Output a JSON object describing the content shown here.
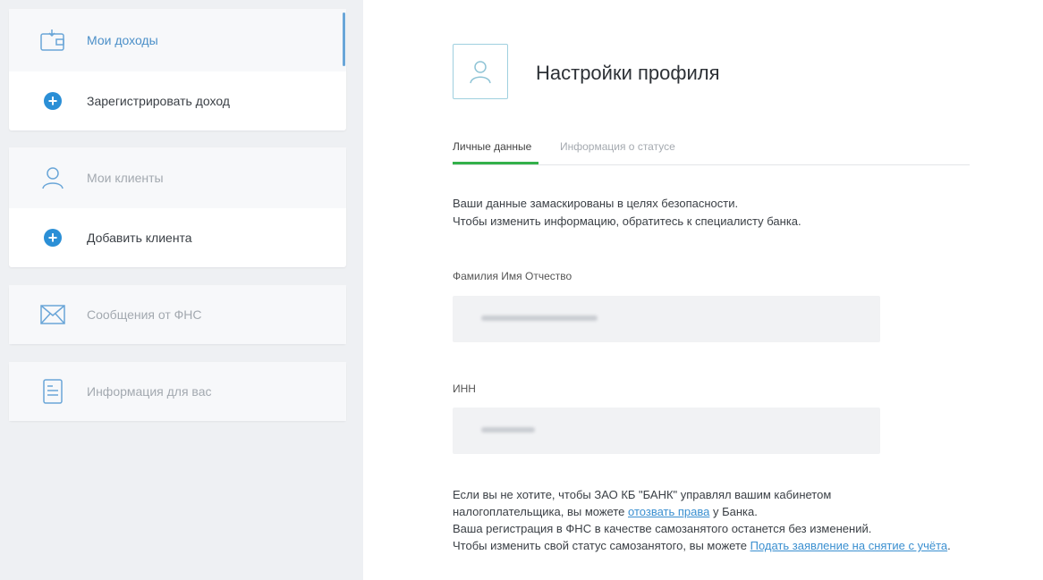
{
  "sidebar": {
    "income": {
      "my_income": "Мои доходы",
      "register_income": "Зарегистрировать доход"
    },
    "clients": {
      "my_clients": "Мои клиенты",
      "add_client": "Добавить клиента"
    },
    "fns_messages": "Сообщения от ФНС",
    "info_for_you": "Информация для вас"
  },
  "profile": {
    "title": "Настройки профиля",
    "tabs": [
      {
        "label": "Личные данные",
        "active": true
      },
      {
        "label": "Информация о статусе",
        "active": false
      }
    ],
    "masked_notice_line1": "Ваши данные замаскированы в целях безопасности.",
    "masked_notice_line2": "Чтобы изменить информацию, обратитесь к специалисту банка.",
    "fio_label": "Фамилия Имя Отчество",
    "inn_label": "ИНН",
    "info": {
      "line1": "Если вы не хотите, чтобы ЗАО КБ \"БАНК\" управлял вашим кабинетом",
      "line2_pre": "налогоплательщика, вы можете ",
      "revoke_link": "отозвать права",
      "line2_post": " у Банка.",
      "line3": "Ваша регистрация в ФНС в качестве самозанятого останется без изменений.",
      "line4_pre": "Чтобы изменить свой статус самозанятого, вы можете ",
      "application_link": "Подать заявление на снятие с учёта",
      "line4_post": "."
    }
  },
  "colors": {
    "accent_green": "#33b04a",
    "link_blue": "#3a8fd0",
    "plus_blue": "#2b8fd6"
  }
}
